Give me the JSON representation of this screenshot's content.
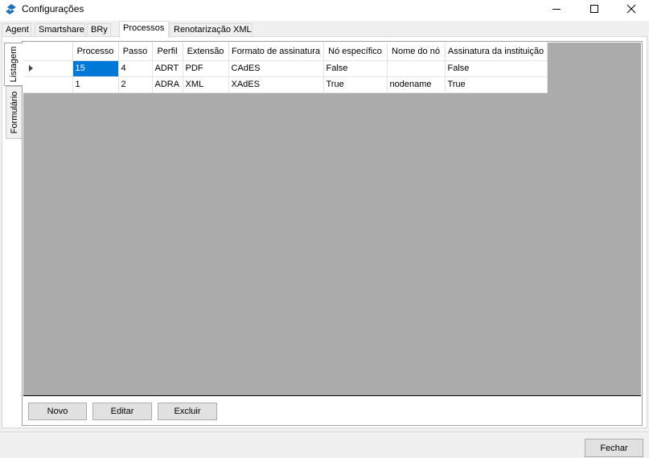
{
  "window": {
    "title": "Configurações"
  },
  "tabs": [
    {
      "label": "Agent"
    },
    {
      "label": "Smartshare"
    },
    {
      "label": "BRy"
    },
    {
      "label": "Processos",
      "active": true
    },
    {
      "label": "Renotarização XML"
    }
  ],
  "side_tabs": [
    {
      "label": "Listagem",
      "active": true
    },
    {
      "label": "Formulário"
    }
  ],
  "grid": {
    "columns": [
      "Processo",
      "Passo",
      "Perfil",
      "Extensão",
      "Formato de assinatura",
      "Nó específico",
      "Nome do nó",
      "Assinatura da instituição"
    ],
    "rows": [
      [
        "15",
        "4",
        "ADRT",
        "PDF",
        "CAdES",
        "False",
        "",
        "False"
      ],
      [
        "1",
        "2",
        "ADRA",
        "XML",
        "XAdES",
        "True",
        "nodename",
        "True"
      ]
    ],
    "selected_row": 0,
    "selected_cell": [
      0,
      0
    ]
  },
  "buttons": {
    "novo": "Novo",
    "editar": "Editar",
    "excluir": "Excluir",
    "fechar": "Fechar"
  },
  "colors": {
    "selection": "#0078d7",
    "grid_background": "#ababab",
    "brand_icon": "#1d6fb8"
  },
  "icons": {
    "app": "app-logo-icon",
    "minimize": "minimize-icon",
    "maximize": "maximize-icon",
    "close": "close-icon",
    "row_indicator": "row-pointer-icon"
  }
}
